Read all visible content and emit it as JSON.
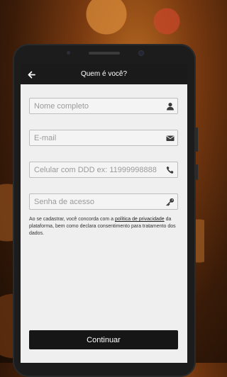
{
  "header": {
    "title": "Quem é você?",
    "back_icon": "arrow-left-icon"
  },
  "form": {
    "name": {
      "placeholder": "Nome completo",
      "value": "",
      "icon": "user-icon"
    },
    "email": {
      "placeholder": "E-mail",
      "value": "",
      "icon": "envelope-icon"
    },
    "phone": {
      "placeholder": "Celular com DDD ex: 11999998888",
      "value": "",
      "icon": "phone-icon"
    },
    "password": {
      "placeholder": "Senha de acesso",
      "value": "",
      "icon": "key-icon"
    }
  },
  "notice": {
    "before": "Ao se cadastrar, você concorda com a ",
    "link": "política de privacidade",
    "after": " da plataforma, bem como declara consentimento para tratamento dos dados."
  },
  "actions": {
    "continue_label": "Continuar"
  },
  "colors": {
    "primary": "#161616",
    "content_bg": "#efefef",
    "border": "#bdbdbd"
  }
}
